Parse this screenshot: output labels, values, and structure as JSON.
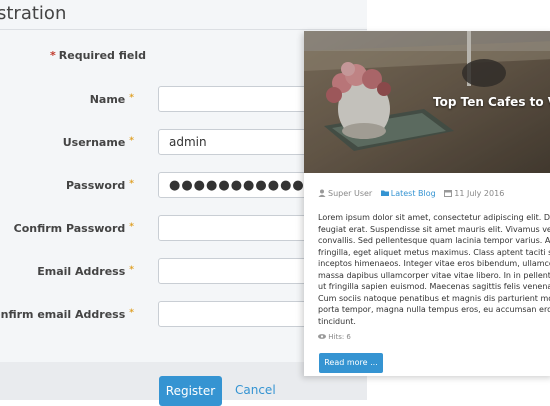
{
  "registration": {
    "title": "istration",
    "required_note": "Required field",
    "required_star": "*",
    "field_star": "*",
    "fields": [
      {
        "label": "Name",
        "value": "",
        "type": "text"
      },
      {
        "label": "Username",
        "value": "admin",
        "type": "text"
      },
      {
        "label": "Password",
        "value": "●●●●●●●●●●●●●●",
        "type": "password"
      },
      {
        "label": "Confirm Password",
        "value": "",
        "type": "password"
      },
      {
        "label": "Email Address",
        "value": "",
        "type": "email"
      },
      {
        "label": "Confirm email Address",
        "value": "",
        "type": "email"
      }
    ],
    "register_label": "Register",
    "cancel_label": "Cancel"
  },
  "blog_card": {
    "hero_title": "Top Ten Cafes to Vis",
    "author": "Super User",
    "category": "Latest Blog",
    "date": "11 July 2016",
    "body_lines": [
      "Lorem ipsum dolor sit amet, consectetur adipiscing elit. Donec",
      "feugiat erat. Suspendisse sit amet mauris elit. Vivamus venena",
      "convallis. Sed pellentesque quam lacinia tempor varius. Aliqua",
      "fringilla, eget aliquet metus maximus. Class aptent taciti socio",
      "inceptos himenaeos. Integer vitae eros bibendum, ullamcorper",
      "massa dapibus ullamcorper vitae vitae libero. In in pellentesqu",
      "ut fringilla sapien euismod. Maecenas sagittis felis venenatis r",
      "Cum sociis natoque penatibus et magnis dis parturient monte",
      "porta tempor, magna nulla tempus eros, eu accumsan eros nibh",
      "tincidunt."
    ],
    "hits": "Hits: 6",
    "read_more": "Read more ...",
    "accent_color": "#3594d2"
  }
}
